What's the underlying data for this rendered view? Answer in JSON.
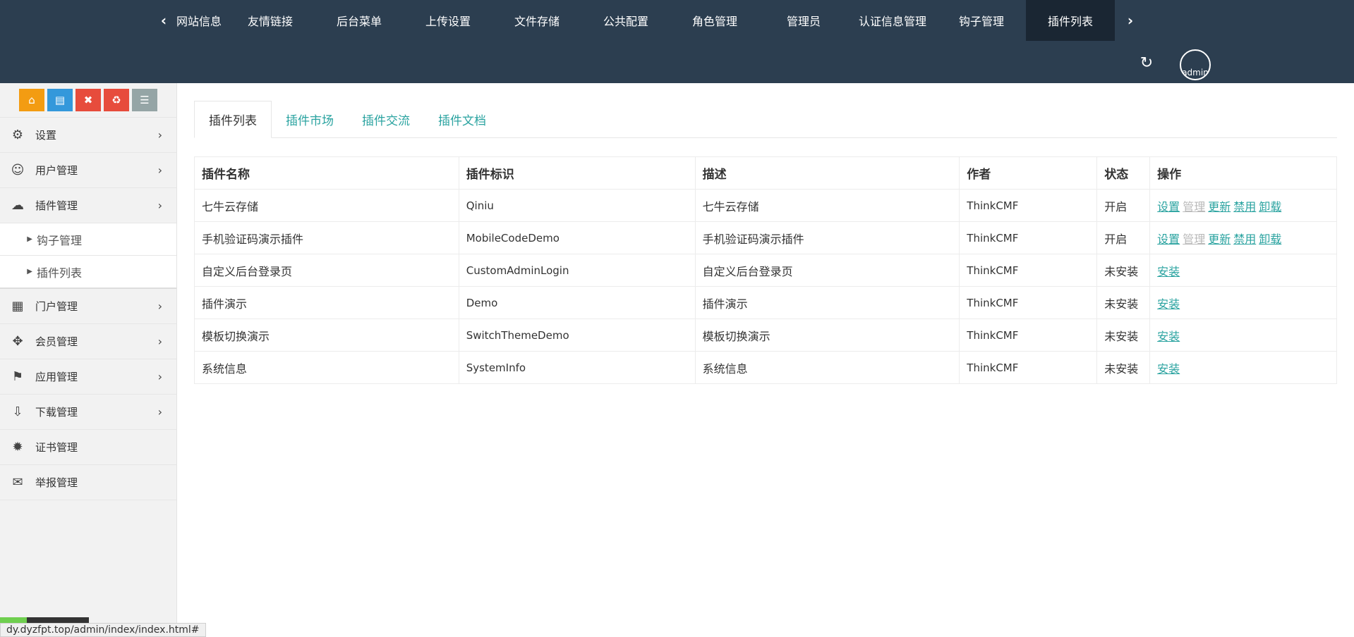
{
  "topnav": {
    "prev_icon": "chevron-left-icon",
    "next_icon": "chevron-right-icon",
    "items": [
      {
        "label": "网站信息"
      },
      {
        "label": "友情链接"
      },
      {
        "label": "后台菜单"
      },
      {
        "label": "上传设置"
      },
      {
        "label": "文件存储"
      },
      {
        "label": "公共配置"
      },
      {
        "label": "角色管理"
      },
      {
        "label": "管理员"
      },
      {
        "label": "认证信息管理"
      },
      {
        "label": "钩子管理"
      },
      {
        "label": "插件列表"
      }
    ],
    "active_index": 10
  },
  "header": {
    "refresh_icon": "refresh-icon",
    "avatar_alt": "admin"
  },
  "shortcuts": [
    {
      "icon": "home-icon",
      "color": "#f39c12"
    },
    {
      "icon": "file-icon",
      "color": "#3498db"
    },
    {
      "icon": "trash-icon",
      "color": "#e74c3c"
    },
    {
      "icon": "recycle-icon",
      "color": "#e74c3c"
    },
    {
      "icon": "list-icon",
      "color": "#95a5a6"
    }
  ],
  "sidebar": {
    "items": [
      {
        "label": "设置",
        "icon": "gears-icon"
      },
      {
        "label": "用户管理",
        "icon": "users-icon"
      },
      {
        "label": "插件管理",
        "icon": "cloud-icon",
        "children": [
          {
            "label": "钩子管理"
          },
          {
            "label": "插件列表"
          }
        ]
      },
      {
        "label": "门户管理",
        "icon": "grid-icon"
      },
      {
        "label": "会员管理",
        "icon": "arrows-icon"
      },
      {
        "label": "应用管理",
        "icon": "android-icon"
      },
      {
        "label": "下载管理",
        "icon": "download-icon"
      },
      {
        "label": "证书管理",
        "icon": "certificate-icon"
      },
      {
        "label": "举报管理",
        "icon": "envelope-open-icon"
      }
    ]
  },
  "tabs": [
    {
      "label": "插件列表"
    },
    {
      "label": "插件市场"
    },
    {
      "label": "插件交流"
    },
    {
      "label": "插件文档"
    }
  ],
  "table": {
    "headers": [
      "插件名称",
      "插件标识",
      "描述",
      "作者",
      "状态",
      "操作"
    ],
    "rows": [
      {
        "name": "七牛云存储",
        "id": "Qiniu",
        "desc": "七牛云存储",
        "author": "ThinkCMF",
        "status": "开启"
      },
      {
        "name": "手机验证码演示插件",
        "id": "MobileCodeDemo",
        "desc": "手机验证码演示插件",
        "author": "ThinkCMF",
        "status": "开启"
      },
      {
        "name": "自定义后台登录页",
        "id": "CustomAdminLogin",
        "desc": "自定义后台登录页",
        "author": "ThinkCMF",
        "status": "未安装"
      },
      {
        "name": "插件演示",
        "id": "Demo",
        "desc": "插件演示",
        "author": "ThinkCMF",
        "status": "未安装"
      },
      {
        "name": "模板切换演示",
        "id": "SwitchThemeDemo",
        "desc": "模板切换演示",
        "author": "ThinkCMF",
        "status": "未安装"
      },
      {
        "name": "系统信息",
        "id": "SystemInfo",
        "desc": "系统信息",
        "author": "ThinkCMF",
        "status": "未安装"
      }
    ],
    "actions_installed": [
      "设置",
      "管理",
      "更新",
      "禁用",
      "卸载"
    ],
    "action_install": "安装"
  },
  "statusbar": {
    "url": "dy.dyzfpt.top/admin/index/index.html#"
  },
  "colors": {
    "header_bg": "#2c3e50",
    "link": "#2aa3a0"
  }
}
